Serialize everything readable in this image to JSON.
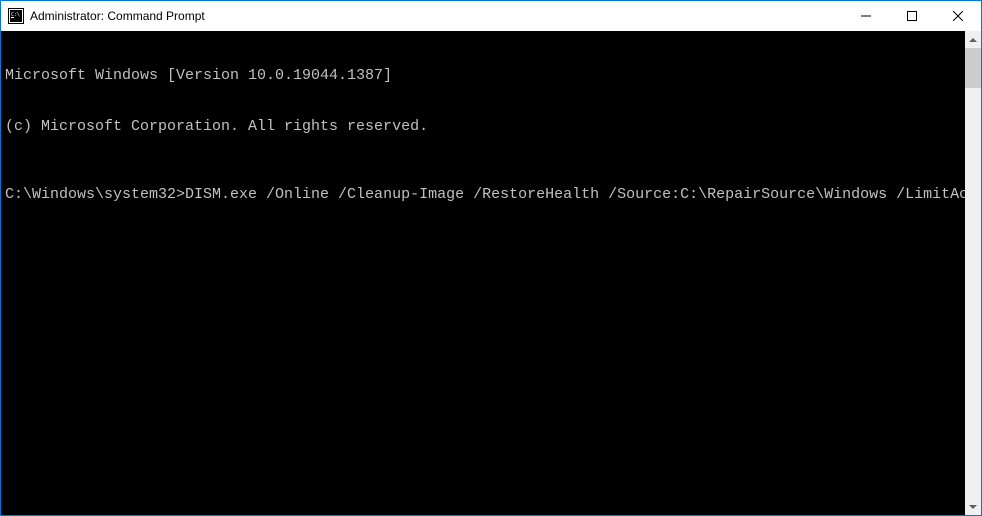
{
  "window": {
    "title": "Administrator: Command Prompt"
  },
  "terminal": {
    "line1": "Microsoft Windows [Version 10.0.19044.1387]",
    "line2": "(c) Microsoft Corporation. All rights reserved.",
    "prompt": "C:\\Windows\\system32>",
    "command": "DISM.exe /Online /Cleanup-Image /RestoreHealth /Source:C:\\RepairSource\\Windows /LimitAccess"
  }
}
